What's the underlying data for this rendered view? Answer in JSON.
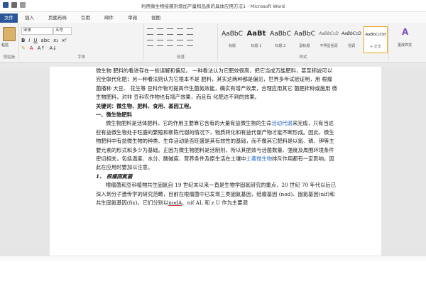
{
  "window": {
    "title": "利用微生物接菌剂增加产量和品质的具体应用方法1 - Microsoft Word"
  },
  "tabs": [
    "文件",
    "插入",
    "页面布局",
    "引用",
    "邮件",
    "审阅",
    "视图"
  ],
  "ribbon": {
    "clipboard_label": "剪贴板",
    "paste_label": "粘贴",
    "font_name": "宋体",
    "font_size": "五号",
    "font_group_label": "字体",
    "paragraph_group_label": "段落",
    "styles_group_label": "样式",
    "edit_label": "更改样式",
    "styles": [
      {
        "sample": "AaBbC",
        "name": "标题"
      },
      {
        "sample": "AaBt",
        "name": "标题 1"
      },
      {
        "sample": "AaBbC",
        "name": "标题 2"
      },
      {
        "sample": "AaBbC",
        "name": "副标题"
      },
      {
        "sample": "AaBbCcD",
        "name": "不明显强调"
      },
      {
        "sample": "AaBbCcD",
        "name": "强调"
      },
      {
        "sample": "AaBbCcDd",
        "name": "+ 正文"
      }
    ]
  },
  "document": {
    "p1": "微生物  肥料的看进存在一些误解和偏见。  一种看法认为它肥效很高，把它当成万能肥料，甚至称說可以完全取代化肥；另一种看法则认为它根本不是  肥料，其实这两种都是偏见，世界多年试验证明，用  根瘤菌播种  大豆、  花生等  豆科作物可提高作生菌氮效能，确实有增产效果，合理应用其它  菌肥拌种或施用  微生物肥料，对非  豆科农作物也有增产效果，而且有  化肥达不到的效果。",
    "keywords": "关键词：微生物、肥料、食用、基因工程。",
    "h1": "一、微生物肥料",
    "p2a": "微生物肥料是活体肥料，它的作用主要靠它含有的大量有益微生物的生命",
    "p2link": "活动代谢",
    "p2b": "来完成，只有当这些有益微生物处于旺盛的繁殖和新陈代谢的情况下，物质转化和有益代谢产物才能不断形成。因此，微生物肥料中有益微生物的种类、生命活动是否旺盛是其有效性的基础，而不像其它肥料是以氮、磷、钾等主要元素的形式和多少为基础。正因为微生物肥料是活制剂，所以其肥效与活菌数量、强度及周围环境条件密切相关，包括温度、水分、酸碱度、营养条件及原生活在土壤中",
    "p2link2": "土著微生物",
    "p2c": "排斥作用都有一定影响，因此在应用时要加以注意。",
    "h2": "1、 根瘤固氮菌",
    "p3a": "根瘤菌和豆科植物共生固氮自 19 世纪末以来一直是生物学固氮研究的重点，20 世纪 70 年代以后已深入到分子遗传学的研究范畴，目前在根瘤菌中已发现三类固氮基因，结瘤基因 (nod)、固氮基因(nif)和共生固氮基因(fix)。它们分别以",
    "p3u": "nodA",
    "p3b": "、nif AL 和  z U 作为主要调"
  }
}
